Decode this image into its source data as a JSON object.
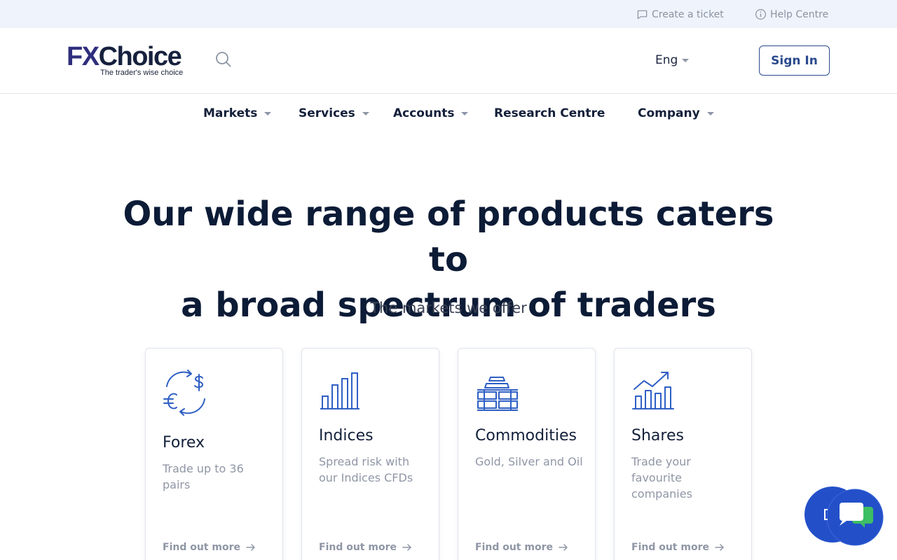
{
  "topbar": {
    "create_ticket": "Create a ticket",
    "help_centre": "Help Centre"
  },
  "header": {
    "logo_fx": "FX",
    "logo_choice": "Choice",
    "logo_tagline": "The trader's wise choice",
    "language": "Eng",
    "sign_in": "Sign In"
  },
  "nav": {
    "items": [
      {
        "label": "Markets",
        "dropdown": true
      },
      {
        "label": "Services",
        "dropdown": true
      },
      {
        "label": "Accounts",
        "dropdown": true
      },
      {
        "label": "Research Centre",
        "dropdown": false
      },
      {
        "label": "Company",
        "dropdown": true
      }
    ]
  },
  "hero": {
    "title_line1": "Our wide range of products caters to",
    "title_line2": "a broad spectrum of traders",
    "subtitle": "The markets we offer"
  },
  "cards": [
    {
      "title": "Forex",
      "description": "Trade up to 36 pairs",
      "link": "Find out more",
      "icon": "currency-exchange-icon"
    },
    {
      "title": "Indices",
      "description": "Spread risk with our Indices CFDs",
      "link": "Find out more",
      "icon": "bar-chart-icon"
    },
    {
      "title": "Commodities",
      "description": "Gold, Silver and Oil",
      "link": "Find out more",
      "icon": "gold-bars-icon"
    },
    {
      "title": "Shares",
      "description": "Trade your favourite companies",
      "link": "Find out more",
      "icon": "growth-chart-icon"
    }
  ],
  "colors": {
    "brand_navy": "#2f2e7d",
    "accent_blue": "#2a4a8c",
    "icon_blue": "#2f5fc4",
    "chat_blue": "#2350c9",
    "chat_green": "#3dbf63"
  }
}
